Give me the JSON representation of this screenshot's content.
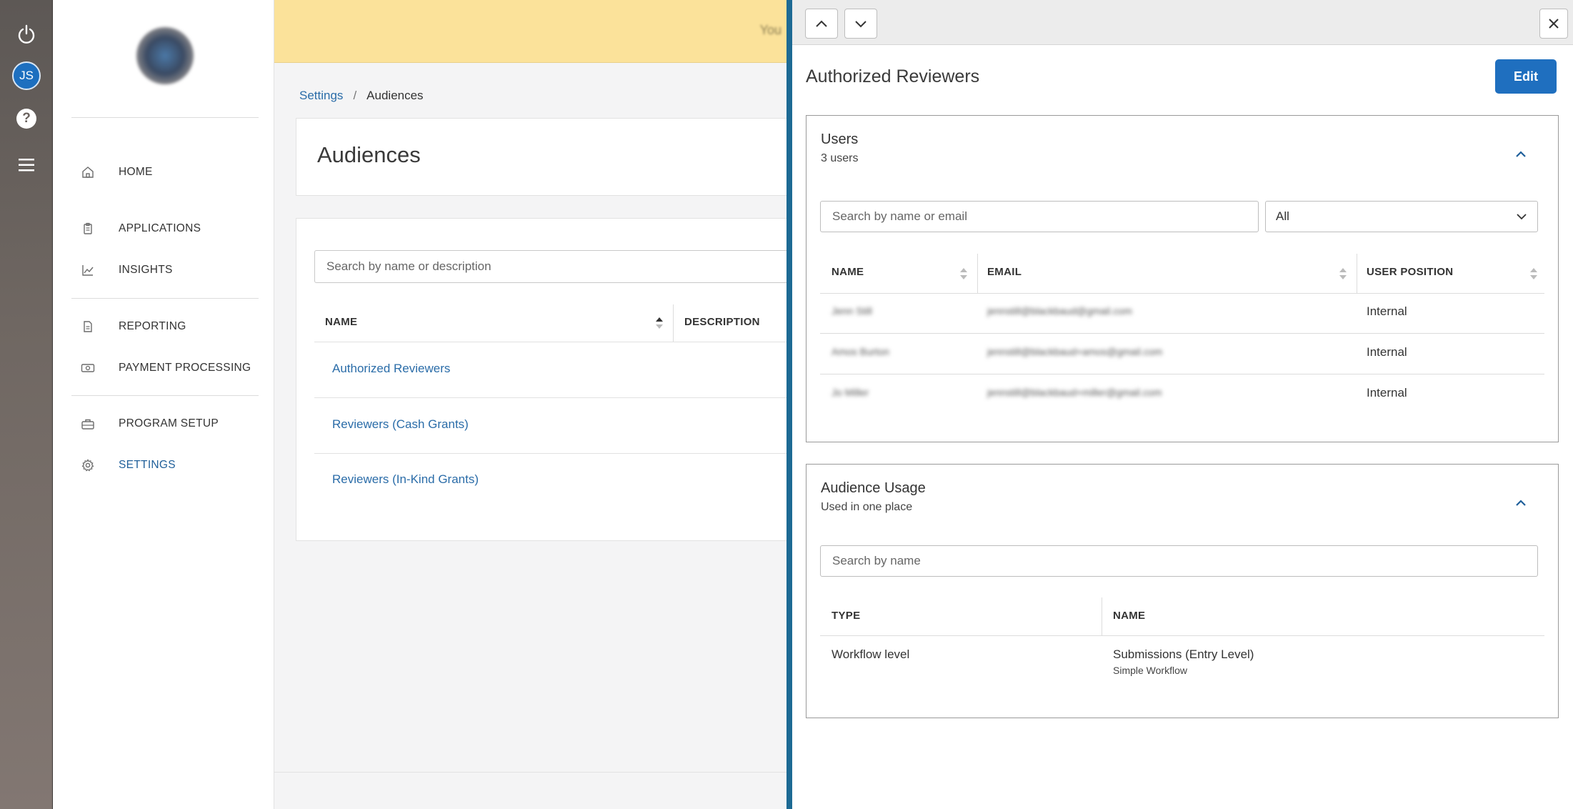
{
  "rail": {
    "avatar_initials": "JS",
    "help_glyph": "?",
    "icons": [
      "power-icon",
      "help-icon",
      "menu-icon"
    ]
  },
  "nav": {
    "items": [
      {
        "label": "HOME",
        "icon": "home-icon"
      },
      {
        "label": "APPLICATIONS",
        "icon": "clipboard-icon"
      },
      {
        "label": "INSIGHTS",
        "icon": "chart-line-icon"
      },
      {
        "label": "REPORTING",
        "icon": "document-icon"
      },
      {
        "label": "PAYMENT PROCESSING",
        "icon": "money-icon"
      },
      {
        "label": "PROGRAM SETUP",
        "icon": "toolbox-icon"
      },
      {
        "label": "SETTINGS",
        "icon": "gear-icon",
        "active": true
      }
    ]
  },
  "banner": {
    "text": "You"
  },
  "breadcrumb": {
    "parent": "Settings",
    "separator": "/",
    "current": "Audiences"
  },
  "page": {
    "title": "Audiences",
    "search_placeholder": "Search by name or description",
    "columns": [
      "NAME",
      "DESCRIPTION"
    ],
    "rows": [
      "Authorized Reviewers",
      "Reviewers (Cash Grants)",
      "Reviewers (In-Kind Grants)"
    ]
  },
  "drawer": {
    "title": "Authorized Reviewers",
    "edit_label": "Edit",
    "users": {
      "title": "Users",
      "subtitle": "3 users",
      "search_placeholder": "Search by name or email",
      "filter_value": "All",
      "columns": [
        "NAME",
        "EMAIL",
        "USER POSITION"
      ],
      "rows": [
        {
          "name": "Jenn Still",
          "email": "jennstill@blackbaud@gmail.com",
          "position": "Internal"
        },
        {
          "name": "Amos Burton",
          "email": "jennstill@blackbaud+amos@gmail.com",
          "position": "Internal"
        },
        {
          "name": "Jo Miller",
          "email": "jennstill@blackbaud+miller@gmail.com",
          "position": "Internal"
        }
      ]
    },
    "usage": {
      "title": "Audience Usage",
      "subtitle": "Used in one place",
      "search_placeholder": "Search by name",
      "columns": [
        "TYPE",
        "NAME"
      ],
      "rows": [
        {
          "type": "Workflow level",
          "name": "Submissions (Entry Level)",
          "sub": "Simple Workflow"
        }
      ]
    }
  },
  "colors": {
    "accent": "#1f6fbf",
    "link": "#2a6ca8",
    "drawer_border": "#1d6a94",
    "banner": "#fbe29a"
  }
}
